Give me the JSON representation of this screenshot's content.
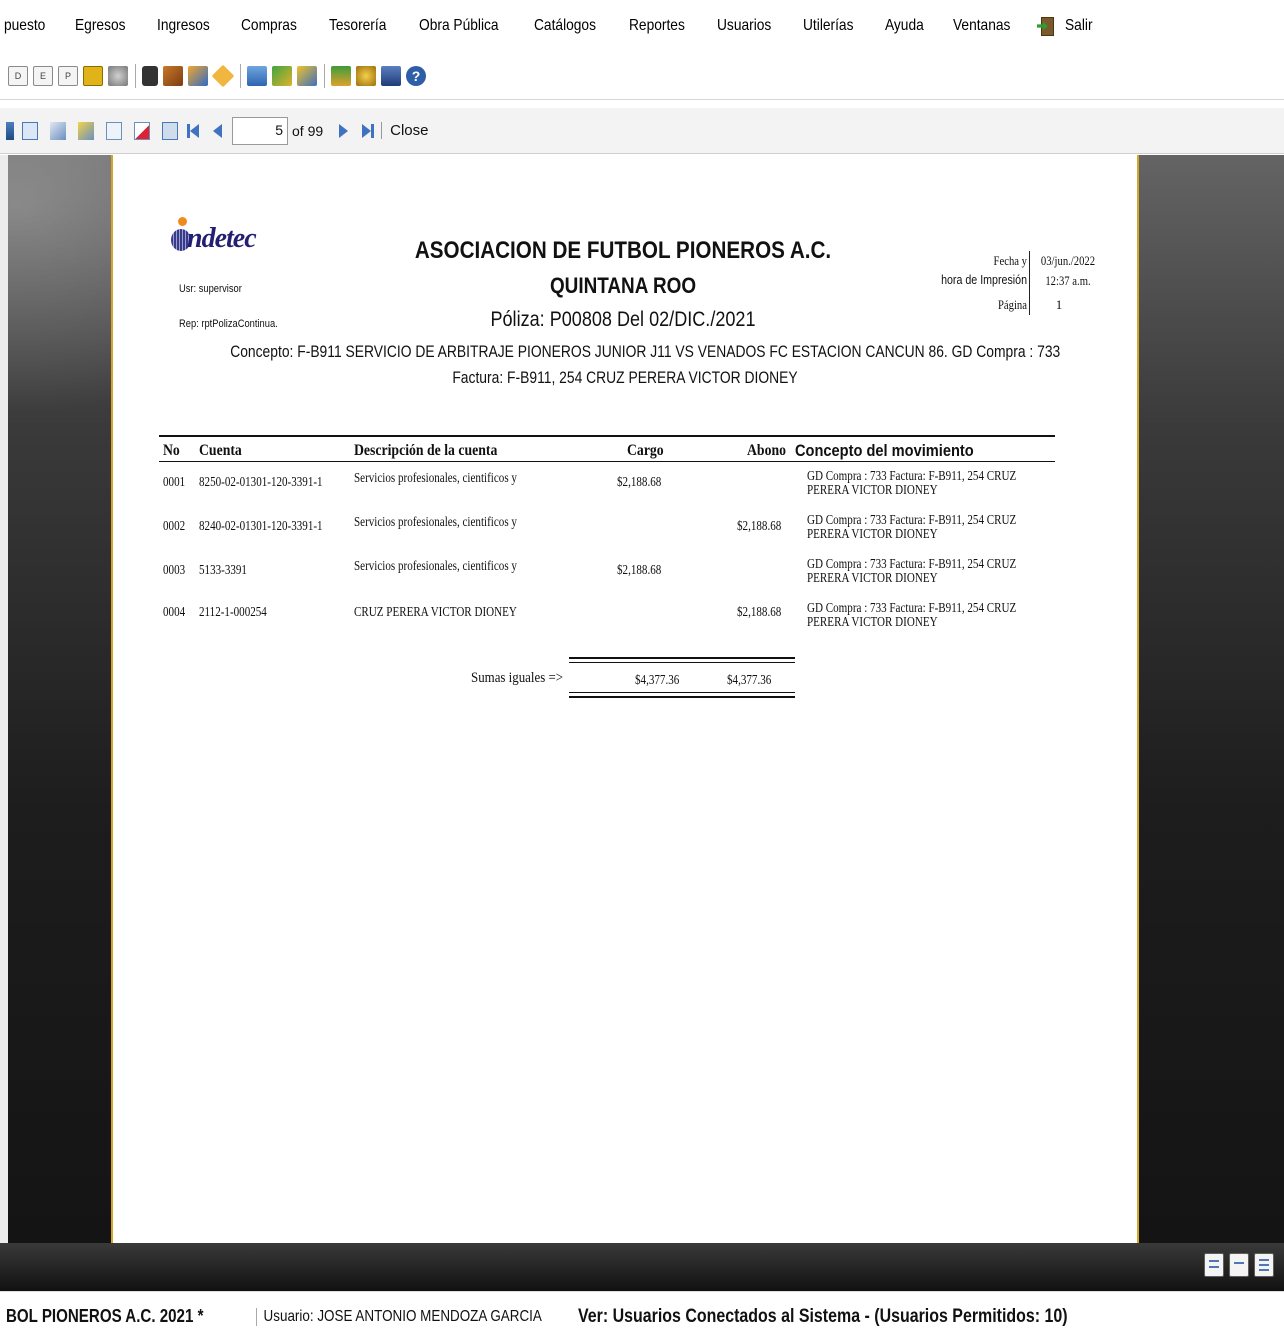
{
  "menu": [
    "puesto",
    "Egresos",
    "Ingresos",
    "Compras",
    "Tesorería",
    "Obra Pública",
    "Catálogos",
    "Reportes",
    "Usuarios",
    "Utilerías",
    "Ayuda",
    "Ventanas"
  ],
  "menu_exit": "Salir",
  "toolbar_letters": [
    "D",
    "E",
    "P"
  ],
  "viewer": {
    "page_current": "5",
    "page_total": "of 99",
    "close": "Close"
  },
  "report": {
    "logo_text": "ndetec",
    "user": "Usr: supervisor",
    "rep": "Rep: rptPolizaContinua.",
    "title1": "ASOCIACION DE FUTBOL PIONEROS A.C.",
    "title2": "QUINTANA ROO",
    "poliza": "Póliza: P00808 Del 02/DIC./2021",
    "concepto": "Concepto: F-B911 SERVICIO DE ARBITRAJE PIONEROS JUNIOR J11 VS VENADOS FC ESTACION CANCUN 86. GD Compra : 733",
    "factura": "Factura: F-B911, 254 CRUZ PERERA VICTOR DIONEY",
    "fecha_label": "Fecha y",
    "hora_label": "hora de Impresión",
    "pagina_label": "Página",
    "fecha": "03/jun./2022",
    "hora": "12:37 a.m.",
    "pagina": "1",
    "headers": {
      "no": "No",
      "cuenta": "Cuenta",
      "desc": "Descripción de la cuenta",
      "cargo": "Cargo",
      "abono": "Abono",
      "concepto": "Concepto del movimiento"
    },
    "rows": [
      {
        "no": "0001",
        "cuenta": "8250-02-01301-120-3391-1",
        "desc": "Servicios profesionales, cientificos y",
        "cargo": "$2,188.68",
        "abono": "",
        "c1": "GD Compra : 733 Factura: F-B911, 254 CRUZ",
        "c2": "PERERA VICTOR DIONEY"
      },
      {
        "no": "0002",
        "cuenta": "8240-02-01301-120-3391-1",
        "desc": "Servicios profesionales, cientificos y",
        "cargo": "",
        "abono": "$2,188.68",
        "c1": "GD Compra : 733 Factura: F-B911, 254 CRUZ",
        "c2": "PERERA VICTOR DIONEY"
      },
      {
        "no": "0003",
        "cuenta": "5133-3391",
        "desc": "Servicios profesionales, cientificos y",
        "cargo": "$2,188.68",
        "abono": "",
        "c1": "GD Compra : 733 Factura: F-B911, 254 CRUZ",
        "c2": "PERERA VICTOR DIONEY"
      },
      {
        "no": "0004",
        "cuenta": "2112-1-000254",
        "desc": "CRUZ PERERA VICTOR DIONEY",
        "cargo": "",
        "abono": "$2,188.68",
        "c1": "GD Compra : 733 Factura: F-B911, 254 CRUZ",
        "c2": "PERERA VICTOR DIONEY"
      }
    ],
    "sumas_label": "Sumas iguales =>",
    "sum_cargo": "$4,377.36",
    "sum_abono": "$4,377.36"
  },
  "status": {
    "company": "BOL PIONEROS A.C.  2021   *",
    "user": "Usuario: JOSE ANTONIO MENDOZA GARCIA",
    "ver": "Ver: Usuarios Conectados al Sistema - (Usuarios Permitidos: 10)"
  }
}
